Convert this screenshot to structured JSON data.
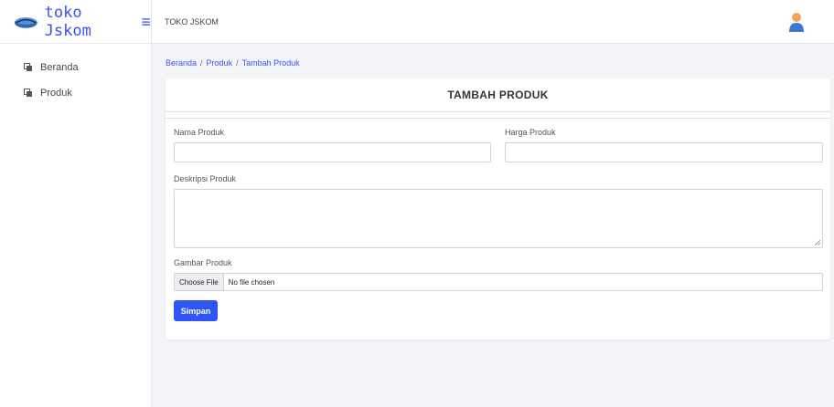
{
  "brand": {
    "name": "toko Jskom",
    "accent": "#3a53f0"
  },
  "sidebar": {
    "items": [
      {
        "label": "Beranda",
        "icon": "copy-icon"
      },
      {
        "label": "Produk",
        "icon": "copy-icon"
      }
    ]
  },
  "topbar": {
    "title": "TOKO JSKOM",
    "avatar_icon": "user-avatar-icon"
  },
  "breadcrumb": {
    "items": [
      "Beranda",
      "Produk",
      "Tambah Produk"
    ],
    "separator": "/"
  },
  "form": {
    "title": "TAMBAH PRODUK",
    "nama_label": "Nama Produk",
    "nama_value": "",
    "harga_label": "Harga Produk",
    "harga_value": "",
    "deskripsi_label": "Deskripsi Produk",
    "deskripsi_value": "",
    "gambar_label": "Gambar Produk",
    "file_button": "Choose File",
    "file_status": "No file chosen",
    "submit_label": "Simpan",
    "submit_color": "#2f55f5"
  }
}
